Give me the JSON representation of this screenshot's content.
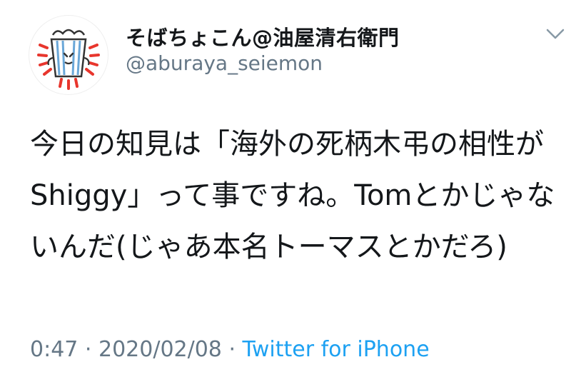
{
  "tweet": {
    "display_name": "そばちょこん@油屋清右衛門",
    "handle": "@aburaya_seiemon",
    "text": "今日の知見は「海外の死柄木弔の相性がShiggy」って事ですね。Tomとかじゃないんだ(じゃあ本名トーマスとかだろ)",
    "time": "0:47",
    "separator1": " · ",
    "date": "2020/02/08",
    "separator2": " · ",
    "source": "Twitter for iPhone"
  },
  "icons": {
    "menu": "chevron-down-icon",
    "avatar": "avatar"
  },
  "colors": {
    "name": "#14171a",
    "secondary": "#657786",
    "link": "#1da1f2",
    "avatar_accent": "#e8362d",
    "avatar_stripe": "#6aa7d8"
  }
}
